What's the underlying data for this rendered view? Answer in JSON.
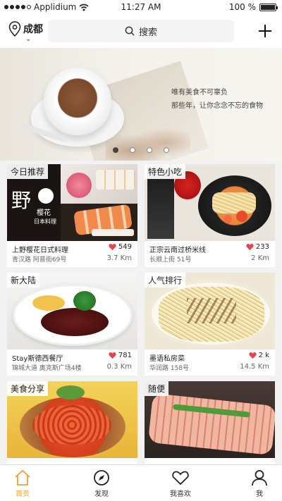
{
  "status_bar": {
    "carrier": "Applidium",
    "time": "11:27 AM",
    "battery": "100 %"
  },
  "header": {
    "city": "成都",
    "search_placeholder": "搜索"
  },
  "banner": {
    "line1": "唯有美食不可辜负",
    "line2": "那些年，让你念念不忘的食物",
    "page_count": 4,
    "active_index": 0
  },
  "cards": [
    {
      "tag": "今日推荐",
      "name": "上野樱花日式料理",
      "address": "青汉路 阿普街69号",
      "likes": "549",
      "distance": "3.7 Km",
      "photo_sign": [
        "野",
        "樱花",
        "日本料理"
      ]
    },
    {
      "tag": "特色小吃",
      "name": "正宗云南过桥米线",
      "address": "长顺上街 51号",
      "likes": "233",
      "distance": "2 Km"
    },
    {
      "tag": "新大陆",
      "name": "Stay斯德西餐厅",
      "address": "锦城大道 奥克斯广场4楼",
      "likes": "781",
      "distance": "0.3 Km"
    },
    {
      "tag": "人气排行",
      "name": "墨语私房菜",
      "address": "华润路 158号",
      "likes": "2 k",
      "distance": "14.5 Km"
    },
    {
      "tag": "美食分享",
      "name": "",
      "address": "",
      "likes": "",
      "distance": ""
    },
    {
      "tag": "随便",
      "name": "",
      "address": "",
      "likes": "",
      "distance": ""
    }
  ],
  "tabbar": {
    "items": [
      {
        "label": "首页",
        "icon": "home-icon"
      },
      {
        "label": "发现",
        "icon": "compass-icon"
      },
      {
        "label": "我喜欢",
        "icon": "heart-icon"
      },
      {
        "label": "我",
        "icon": "person-icon"
      }
    ],
    "active": 0
  },
  "colors": {
    "accent": "#e8a23a",
    "like": "#e2474f"
  }
}
